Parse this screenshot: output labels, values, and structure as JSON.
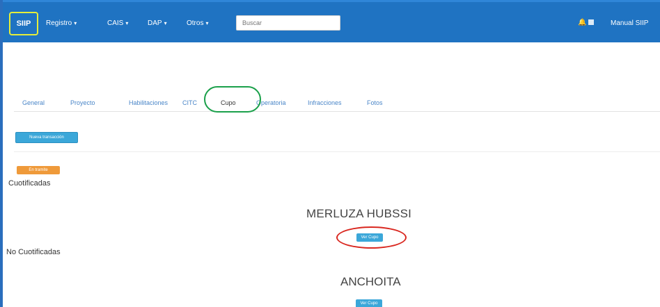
{
  "navbar": {
    "brand": "SIIP",
    "menu": [
      {
        "label": "Registro",
        "has_caret": true
      },
      {
        "label": "CAIS",
        "has_caret": true
      },
      {
        "label": "DAP",
        "has_caret": true
      },
      {
        "label": "Otros",
        "has_caret": true
      }
    ],
    "search_placeholder": "Buscar",
    "user_label": "Manual SIIP",
    "bell_icon": "bell-icon",
    "colors": {
      "bar": "#1f73c2",
      "brand_highlight": "#e6ee3a"
    }
  },
  "tabs": [
    {
      "label": "General",
      "active": false
    },
    {
      "label": "Proyecto",
      "active": false
    },
    {
      "label": "Habilitaciones",
      "active": false
    },
    {
      "label": "CITC",
      "active": false
    },
    {
      "label": "Cupo",
      "active": true
    },
    {
      "label": "Operatoria",
      "active": false
    },
    {
      "label": "Infracciones",
      "active": false
    },
    {
      "label": "Fotos",
      "active": false
    }
  ],
  "actions": {
    "new_button": "Nueva transacción"
  },
  "status_badge": "En tramite",
  "sections": {
    "certified": "Cuotificadas",
    "not_certified": "No Cuotificadas"
  },
  "species": [
    {
      "name": "MERLUZA HUBSSI",
      "button": "Ver Cupo"
    },
    {
      "name": "ANCHOITA",
      "button": "Ver Cupo"
    }
  ],
  "annotations": {
    "green_highlight_color": "#1aa04a",
    "red_highlight_color": "#d9271f"
  }
}
